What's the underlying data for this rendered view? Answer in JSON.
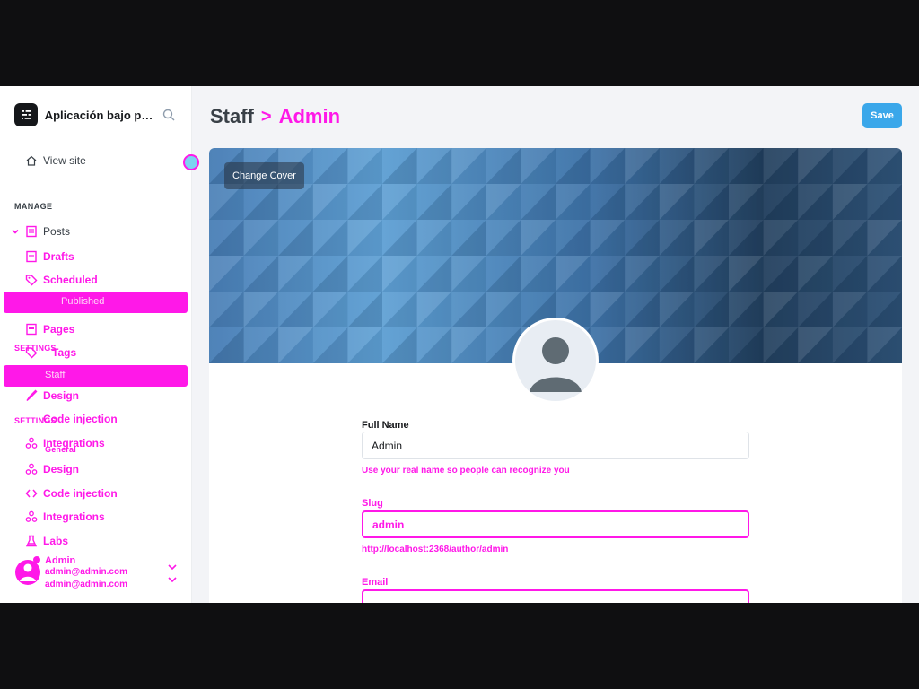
{
  "app": {
    "name": "Aplicación bajo pr..."
  },
  "sidebar": {
    "view_site": "View site",
    "manage_label": "MANAGE",
    "posts": "Posts",
    "post_filters": [
      "Drafts",
      "Scheduled",
      "Published"
    ],
    "drafts_count": "Drafts",
    "scheduled_prefix": "Scheduled",
    "items": [
      "Pages",
      "Tags",
      "Design",
      "Code injection",
      "Integrations",
      "Labs"
    ],
    "ghost_items": [
      "Pages",
      "Tags",
      "Staff",
      "Design",
      "Code injection",
      "Integrations",
      "Labs"
    ],
    "settings_label": "SETTINGS",
    "settings_label_2": "SETTINGS",
    "general": "General",
    "staff": "Staff",
    "user": {
      "name": "Admin",
      "email": "admin@admin.com"
    }
  },
  "header": {
    "parent": "Staff",
    "separator": ">",
    "current": "Admin",
    "save": "Save"
  },
  "cover": {
    "change_cover": "Change Cover"
  },
  "form": {
    "full_name_label": "Full Name",
    "full_name_value": "Admin",
    "full_name_hint": "Use your real name so people can recognize you",
    "slug_label": "Slug",
    "slug_value": "admin",
    "slug_hint": "http://localhost:2368/author/admin",
    "email_label": "Email"
  },
  "colors": {
    "accent": "#ff18e8",
    "save": "#3aa7ea",
    "text": "#15171a"
  }
}
